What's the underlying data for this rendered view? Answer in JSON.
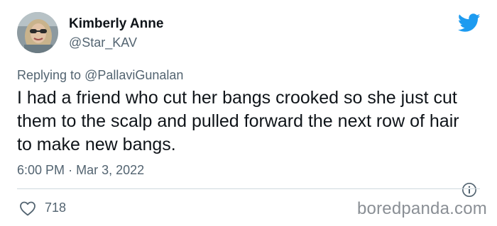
{
  "author": {
    "display_name": "Kimberly Anne",
    "handle": "@Star_KAV"
  },
  "reply": {
    "prefix": "Replying to",
    "mention": "@PallaviGunalan"
  },
  "tweet": {
    "text": "I had a friend who cut her bangs crooked so she just cut them to the scalp and pulled forward the next row of hair to make new bangs.",
    "time": "6:00 PM",
    "separator": "·",
    "date": "Mar 3, 2022"
  },
  "stats": {
    "likes": "718"
  },
  "watermark": "boredpanda.com",
  "icons": {
    "brand": "twitter-bird-icon",
    "info": "info-icon",
    "like": "heart-icon"
  },
  "colors": {
    "twitter_blue": "#1d9bf0",
    "secondary_text": "#536471",
    "primary_text": "#0f1419",
    "divider": "#cfd9de"
  }
}
